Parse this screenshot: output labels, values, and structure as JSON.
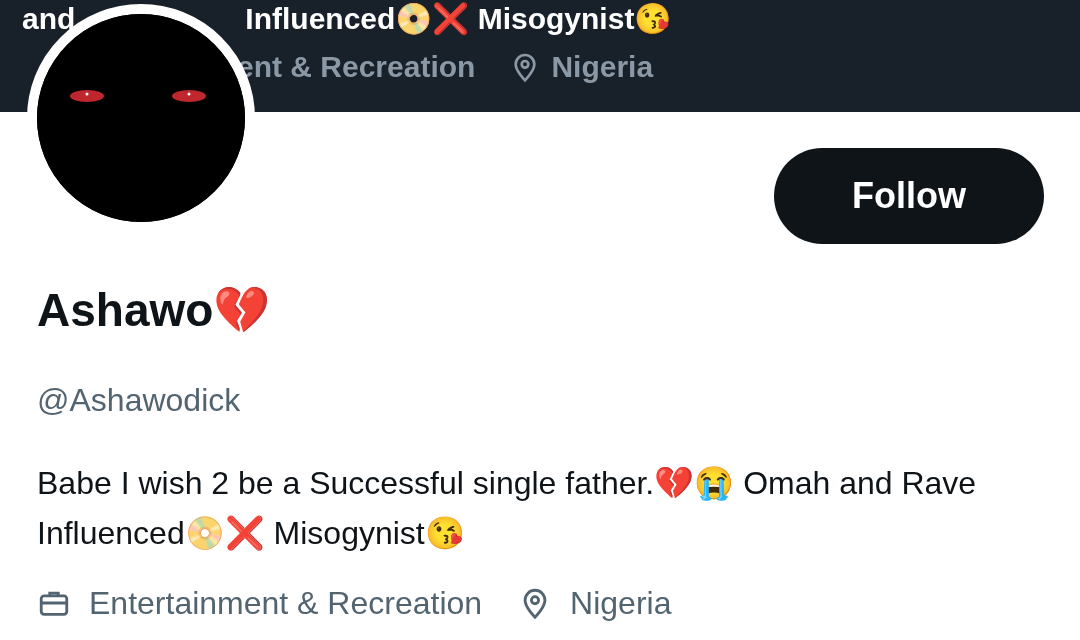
{
  "banner": {
    "bio_fragments": [
      "and",
      "Influenced📀❌ Misogynist😘"
    ],
    "category": "ent & Recreation",
    "location": "Nigeria"
  },
  "profile": {
    "follow_button": "Follow",
    "name": "Ashawo💔",
    "handle": "@Ashawodick",
    "bio": "Babe I wish 2 be a Successful single father.💔😭 Omah and Rave Influenced📀❌ Misogynist😘",
    "category": "Entertainment & Recreation",
    "location": "Nigeria"
  }
}
